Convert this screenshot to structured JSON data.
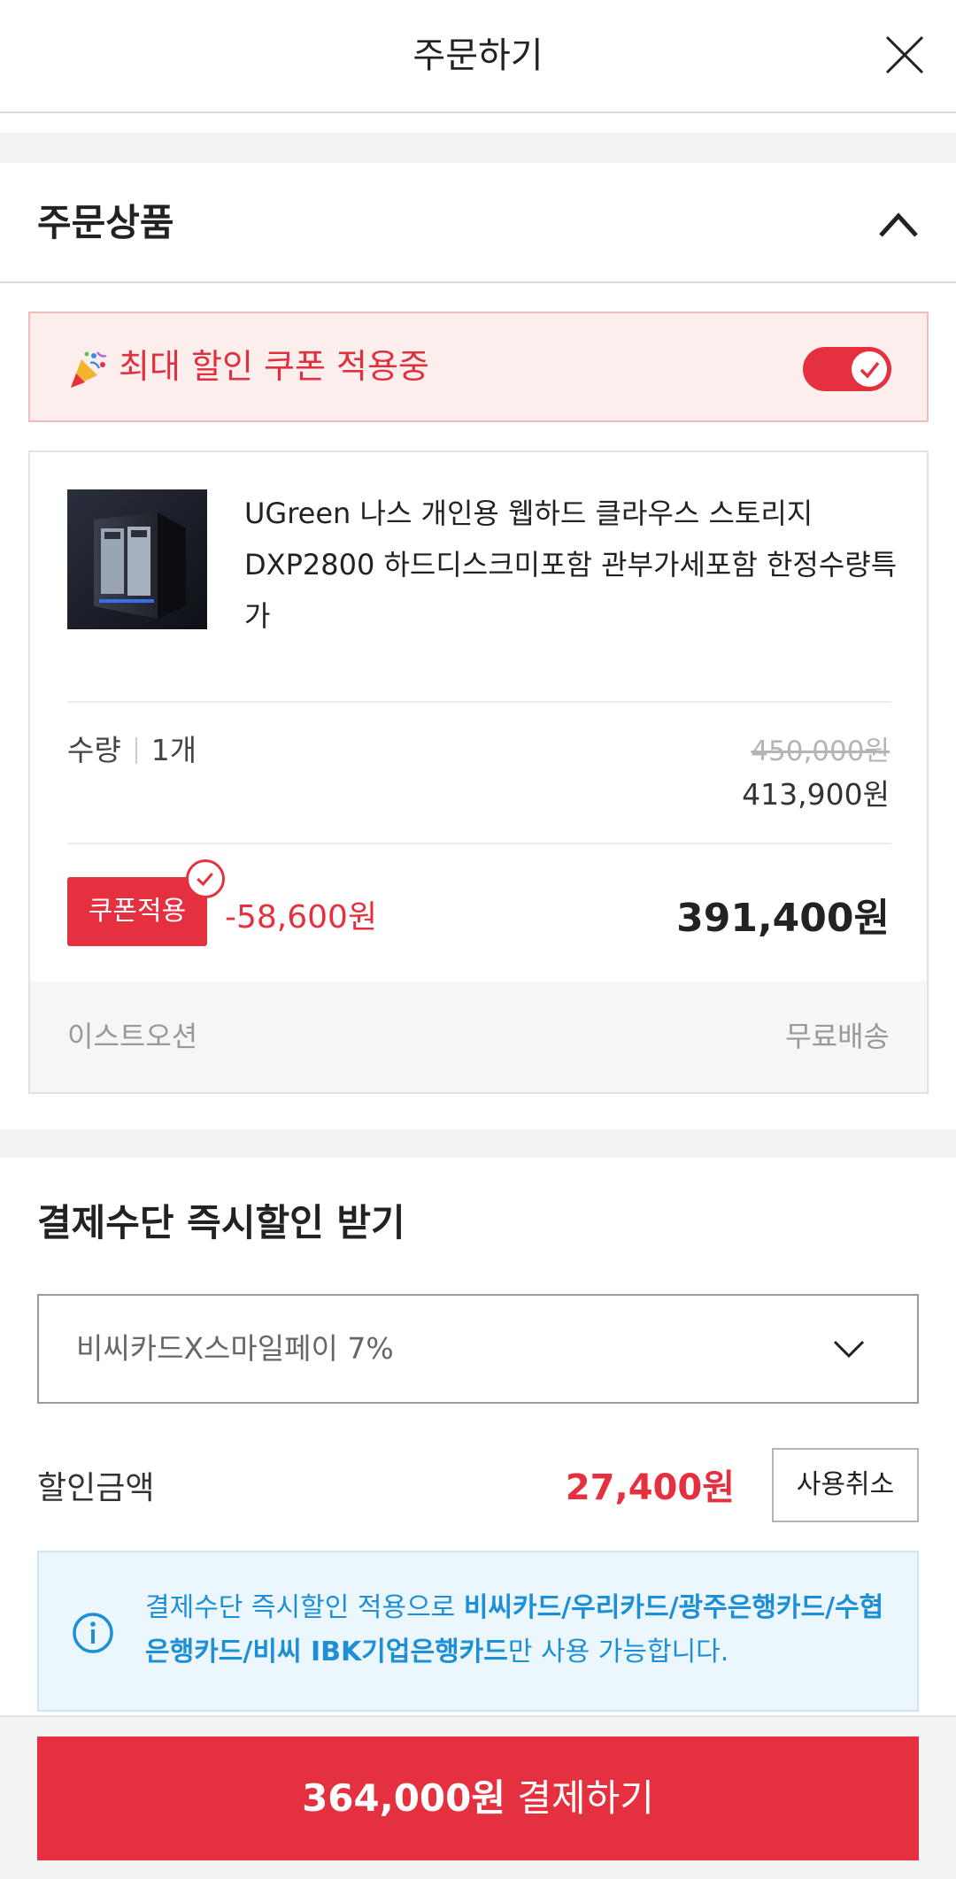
{
  "header": {
    "title": "주문하기"
  },
  "order_section": {
    "title": "주문상품"
  },
  "coupon_banner": {
    "text": "최대 할인 쿠폰 적용중"
  },
  "product": {
    "name": "UGreen 나스 개인용 웹하드 클라우스 스토리지 DXP2800 하드디스크미포함 관부가세포함 한정수량특가",
    "qty_label": "수량",
    "qty_value": "1개",
    "original_price": "450,000원",
    "sale_price": "413,900원",
    "coupon_badge": "쿠폰적용",
    "coupon_discount": "-58,600원",
    "final_price": "391,400원",
    "seller": "이스트오션",
    "shipping": "무료배송"
  },
  "payment_discount": {
    "title": "결제수단 즉시할인 받기",
    "selected_option": "비씨카드X스마일페이 7%",
    "discount_label": "할인금액",
    "discount_amount": "27,400원",
    "cancel_label": "사용취소",
    "info_prefix": "결제수단 즉시할인 적용으로 ",
    "info_cards": "비씨카드/우리카드/광주은행카드/수협은행카드/비씨 IBK기업은행카드",
    "info_suffix": "만 사용 가능합니다."
  },
  "checkout": {
    "amount": "364,000원",
    "label": " 결제하기"
  },
  "colors": {
    "accent": "#e5313f",
    "info_blue": "#1d8fd6",
    "info_bg": "#ecf7fd"
  },
  "icons": [
    "close-icon",
    "chevron-up-icon",
    "party-icon",
    "check-icon",
    "chevron-down-icon",
    "info-icon"
  ]
}
